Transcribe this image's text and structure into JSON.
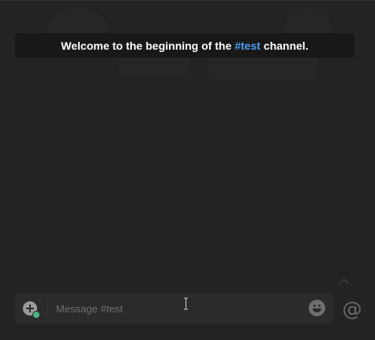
{
  "welcome": {
    "prefix": "Welcome to the beginning of the",
    "channel": "#test",
    "suffix": "channel."
  },
  "composer": {
    "placeholder": "Message #test",
    "value": "",
    "attach_icon": "plus-circle-icon",
    "emoji_icon": "smiley-face-icon"
  },
  "mention": {
    "label": "@"
  },
  "scroll": {
    "icon": "chevron-up-icon"
  },
  "colors": {
    "background": "#232323",
    "banner_bg": "#161616",
    "channel_link": "#4aa0f0",
    "composer_bg": "#2b2b2b",
    "badge_green": "#43b581"
  }
}
